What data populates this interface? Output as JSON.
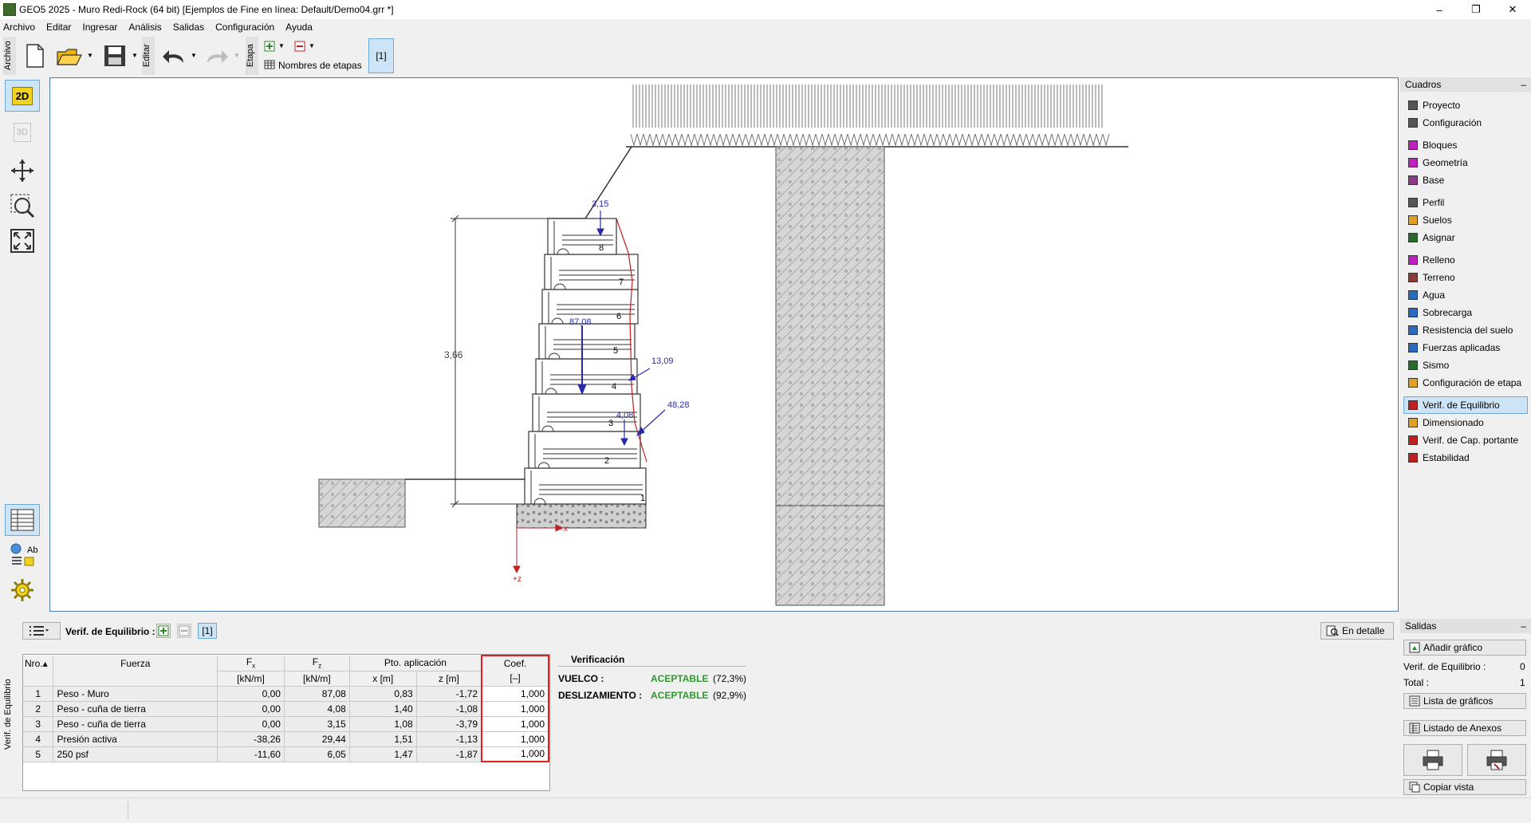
{
  "window": {
    "title": "GEO5 2025 - Muro Redi-Rock  (64 bit) [Ejemplos de Fine en línea: Default/Demo04.grr *]",
    "minimize": "–",
    "restore": "❐",
    "close": "✕"
  },
  "menu": [
    "Archivo",
    "Editar",
    "Ingresar",
    "Análisis",
    "Salidas",
    "Configuración",
    "Ayuda"
  ],
  "toolbar": {
    "group_archivo": "Archivo",
    "group_editar": "Editar",
    "group_etapa": "Etapa",
    "stage_names": "Nombres de etapas",
    "stage_tab": "[1]"
  },
  "left_tools": {
    "view_2d": "2D",
    "view_3d": "3D",
    "table_ab": "Ab"
  },
  "drawing": {
    "height_label": "3,66",
    "block_numbers": [
      "1",
      "2",
      "3",
      "4",
      "5",
      "6",
      "7",
      "8"
    ],
    "force_labels": [
      "3,15",
      "87,08",
      "13,09",
      "48,28",
      "4,08"
    ],
    "axis_x": "+x",
    "axis_z": "+z"
  },
  "frames": {
    "title": "Cuadros",
    "collapse": "–",
    "items": [
      {
        "label": "Proyecto",
        "icon": "document-icon",
        "color": "#555555"
      },
      {
        "label": "Configuración",
        "icon": "gear-icon",
        "color": "#555555"
      },
      {
        "label": "Bloques",
        "icon": "blocks-icon",
        "color": "#c020c0"
      },
      {
        "label": "Geometría",
        "icon": "geometry-icon",
        "color": "#c020c0"
      },
      {
        "label": "Base",
        "icon": "base-icon",
        "color": "#8a3a8a"
      },
      {
        "label": "Perfil",
        "icon": "profile-icon",
        "color": "#555555"
      },
      {
        "label": "Suelos",
        "icon": "soils-icon",
        "color": "#e0a020"
      },
      {
        "label": "Asignar",
        "icon": "assign-icon",
        "color": "#2a6a2a"
      },
      {
        "label": "Relleno",
        "icon": "backfill-icon",
        "color": "#c020c0"
      },
      {
        "label": "Terreno",
        "icon": "terrain-icon",
        "color": "#8a3a3a"
      },
      {
        "label": "Agua",
        "icon": "water-icon",
        "color": "#2a6ac0"
      },
      {
        "label": "Sobrecarga",
        "icon": "surcharge-icon",
        "color": "#2a6ac0"
      },
      {
        "label": "Resistencia del suelo",
        "icon": "resistance-icon",
        "color": "#2a6ac0"
      },
      {
        "label": "Fuerzas aplicadas",
        "icon": "forces-icon",
        "color": "#2a6ac0"
      },
      {
        "label": "Sismo",
        "icon": "earthquake-icon",
        "color": "#2a6a2a"
      },
      {
        "label": "Configuración de etapa",
        "icon": "stage-settings-icon",
        "color": "#e0a020"
      },
      {
        "label": "Verif. de Equilibrio",
        "icon": "equilibrium-icon",
        "color": "#c02020"
      },
      {
        "label": "Dimensionado",
        "icon": "dimensioning-icon",
        "color": "#e0a020"
      },
      {
        "label": "Verif. de Cap. portante",
        "icon": "bearing-icon",
        "color": "#c02020"
      },
      {
        "label": "Estabilidad",
        "icon": "stability-icon",
        "color": "#c02020"
      }
    ]
  },
  "analysis": {
    "panel_label": "Verif. de Equilibrio",
    "title": "Verif. de Equilibrio :",
    "stage": "[1]",
    "details_button": "En detalle",
    "columns": {
      "nro": "Nro.",
      "fuerza": "Fuerza",
      "fx": "F",
      "fx_sub": "x",
      "fz": "F",
      "fz_sub": "z",
      "unit_fx": "[kN/m]",
      "unit_fz": "[kN/m]",
      "pto": "Pto. aplicación",
      "x": "x [m]",
      "z": "z [m]",
      "coef": "Coef.",
      "coef_unit": "[–]"
    },
    "rows": [
      {
        "nro": "1",
        "fuerza": "Peso - Muro",
        "fx": "0,00",
        "fz": "87,08",
        "x": "0,83",
        "z": "-1,72",
        "coef": "1,000"
      },
      {
        "nro": "2",
        "fuerza": "Peso - cuña de tierra",
        "fx": "0,00",
        "fz": "4,08",
        "x": "1,40",
        "z": "-1,08",
        "coef": "1,000"
      },
      {
        "nro": "3",
        "fuerza": "Peso - cuña de tierra",
        "fx": "0,00",
        "fz": "3,15",
        "x": "1,08",
        "z": "-3,79",
        "coef": "1,000"
      },
      {
        "nro": "4",
        "fuerza": "Presión activa",
        "fx": "-38,26",
        "fz": "29,44",
        "x": "1,51",
        "z": "-1,13",
        "coef": "1,000"
      },
      {
        "nro": "5",
        "fuerza": "250 psf",
        "fx": "-11,60",
        "fz": "6,05",
        "x": "1,47",
        "z": "-1,87",
        "coef": "1,000"
      }
    ],
    "verification": {
      "title": "Verificación",
      "vuelco_label": "VUELCO :",
      "vuelco_result": "ACEPTABLE",
      "vuelco_pct": "(72,3%)",
      "desl_label": "DESLIZAMIENTO :",
      "desl_result": "ACEPTABLE",
      "desl_pct": "(92,9%)",
      "ok_color": "#2e9a2e"
    }
  },
  "outputs": {
    "title": "Salidas",
    "collapse": "–",
    "add_graphic": "Añadir gráfico",
    "verif_label": "Verif. de Equilibrio :",
    "verif_count": "0",
    "total_label": "Total :",
    "total_count": "1",
    "graphics_list": "Lista de gráficos",
    "annex_list": "Listado de Anexos",
    "copy_view": "Copiar vista"
  }
}
